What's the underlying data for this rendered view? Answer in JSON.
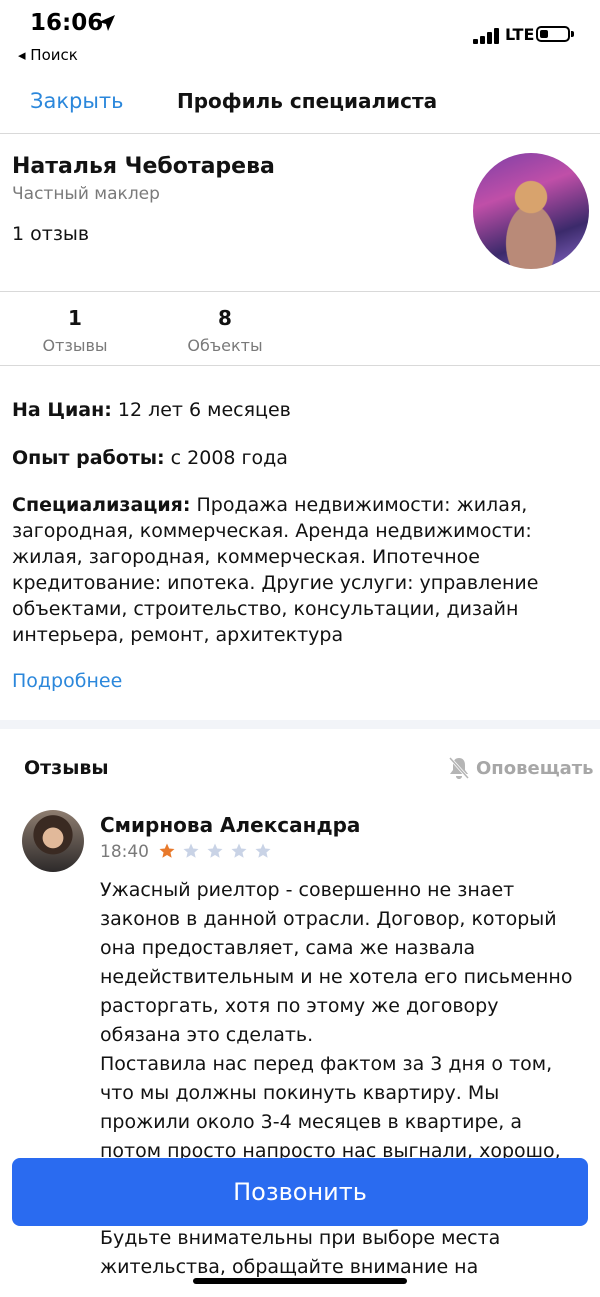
{
  "status_bar": {
    "time": "16:06",
    "back_label": "◂ Поиск",
    "network": "LTE"
  },
  "nav": {
    "close_label": "Закрыть",
    "title": "Профиль специалиста"
  },
  "profile": {
    "name": "Наталья Чеботарева",
    "role": "Частный маклер",
    "reviews_text": "1 отзыв"
  },
  "stats": [
    {
      "value": "1",
      "label": "Отзывы"
    },
    {
      "value": "8",
      "label": "Объекты"
    }
  ],
  "info": {
    "cian_label": "На Циан:",
    "cian_value": "12 лет 6 месяцев",
    "experience_label": "Опыт работы:",
    "experience_value": "с 2008 года",
    "spec_label": "Специализация:",
    "spec_value": "Продажа недвижимости: жилая, загородная, коммерческая. Аренда недвижимости: жилая, загородная, коммерческая. Ипотечное кредитование: ипотека. Другие услуги: управление объектами, строительство, консультации, дизайн интерьера, ремонт, архитектура",
    "more_label": "Подробнее"
  },
  "reviews": {
    "title": "Отзывы",
    "notify_label": "Оповещать",
    "items": [
      {
        "author": "Смирнова Александра",
        "time": "18:40",
        "rating": 1,
        "rating_max": 5,
        "text": "Ужасный риелтор - совершенно не знает законов в данной отрасли. Договор, который она предоставляет, сама же назвала недействительным и не хотела его письменно расторгать, хотя по этому же договору обязана это сделать.\nПоставила нас перед фактом за 3 дня о том, что мы должны покинуть квартиру. Мы прожили около 3-4 месяцев в квартире, а потом просто напросто нас выгнали, хорошо,\n\n«специалиста», поэтому на этом закончу.\nБудьте внимательны при выборе места жительства, обращайте внимание на"
      }
    ]
  },
  "call_button": {
    "label": "Позвонить"
  },
  "colors": {
    "accent": "#2b87db",
    "button": "#2a6bf0",
    "star_active": "#e8792b",
    "star_inactive": "#c9d3e6"
  }
}
